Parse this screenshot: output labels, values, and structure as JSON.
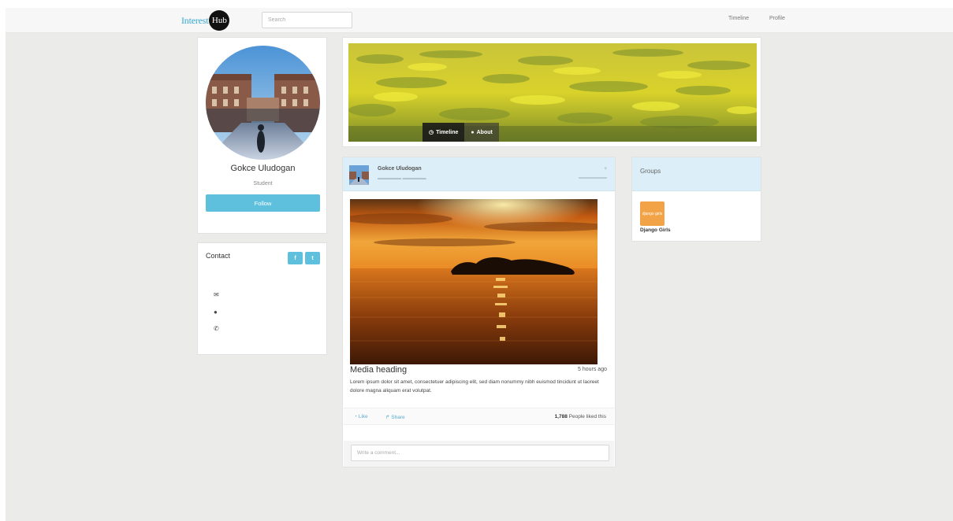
{
  "navbar": {
    "brand_text": "Interest",
    "brand_badge": "Hub",
    "search_placeholder": "Search",
    "links": [
      "Timeline",
      "Profile"
    ]
  },
  "profile": {
    "name": "Gokce Uludogan",
    "role": "Student",
    "follow_label": "Follow"
  },
  "contact": {
    "title": "Contact",
    "facebook_glyph": "f",
    "twitter_glyph": "t",
    "icons": [
      "envelope-icon",
      "map-marker-icon",
      "phone-icon"
    ]
  },
  "cover": {
    "tabs": [
      "Timeline",
      "About"
    ]
  },
  "post": {
    "author": "Gokce Uludogan",
    "media_heading": "Media heading",
    "time": "5 hours ago",
    "body": "Lorem ipsum dolor sit amet, consectetuer adipiscing elit, sed diam nonummy nibh euismod tincidunt ut laoreet dolore magna aliquam erat volutpat.",
    "like_label": "Like",
    "share_label": "Share",
    "likes_count": "1,788",
    "likes_text": "People liked this",
    "comment_placeholder": "Write a comment..."
  },
  "groups": {
    "title": "Groups",
    "items": [
      {
        "name": "Django Girls",
        "logo_text": "django girls"
      }
    ]
  },
  "colors": {
    "accent": "#5ec0dc",
    "panel_header": "#dceef7",
    "background": "#ebebea",
    "group_logo": "#f2a347"
  }
}
